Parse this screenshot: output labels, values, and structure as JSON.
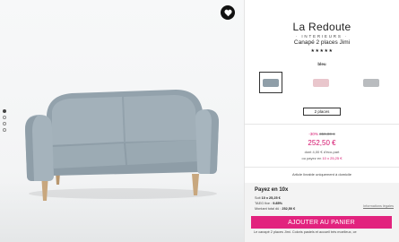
{
  "brand": {
    "name": "La Redoute",
    "sub": "· INTERIEURS ·"
  },
  "product": {
    "title": "Canapé 2 places Jimi",
    "stars": "★★★★★"
  },
  "color": {
    "label": "bleu",
    "swatches": [
      {
        "name": "bleu",
        "hex": "#9aa9b3",
        "selected": true
      },
      {
        "name": "rose",
        "hex": "#e9c6cc",
        "selected": false
      },
      {
        "name": "gris",
        "hex": "#b9bcbf",
        "selected": false
      }
    ]
  },
  "size": {
    "selected": "2 places"
  },
  "price": {
    "discount": "-30%",
    "old": "359,00 €",
    "current": "252,50 €",
    "ecopart": "dont 4,00 € d'éco-part",
    "pay_prefix": "ou payez en",
    "pay_highlight": "10 x 25,25 €"
  },
  "delivery": "Article livrable uniquement à domicile",
  "pay10": {
    "title": "Payez en 10x",
    "row1_label": "Soit",
    "row1_value": "10 x 25,25 €",
    "row2_label": "TAEG fixe :",
    "row2_value": "9.85%",
    "row3_label": "Montant total dû :",
    "row3_value": "252,50 €",
    "info": "Informations légales"
  },
  "description": "Le canapé 2 places Jimi. Coloris pastels et accueil très moelleux, ce",
  "cart_button": "AJOUTER AU PANIER",
  "gallery": {
    "dots": 4,
    "active": 0
  },
  "colors": {
    "accent": "#e2237e",
    "price": "#d4126c",
    "sofa": "#9aa9b3",
    "legs": "#c8a77e"
  }
}
